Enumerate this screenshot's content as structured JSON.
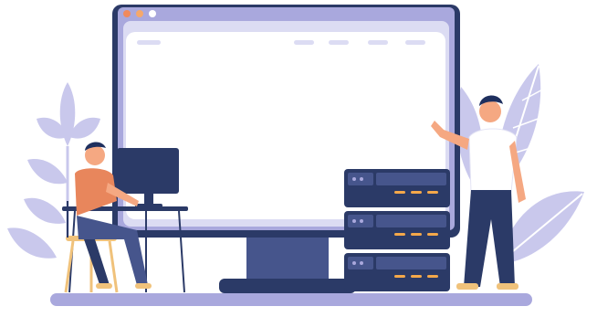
{
  "illustration": {
    "colors": {
      "monitor_bezel": "#2b3a67",
      "monitor_frame": "#a9a8dd",
      "screen": "#ffffff",
      "screen_bar": "#dcdcf3",
      "dot_red": "#f08a5d",
      "dot_orange": "#f5a86b",
      "dot_white": "#ffffff",
      "server_dark": "#2b3a67",
      "server_light": "#46558c",
      "server_led": "#f4a84a",
      "leaf": "#c9c8ec",
      "leaf_vein": "#ffffff",
      "ground": "#a9a8dd",
      "man_left_shirt": "#e8865c",
      "man_pants": "#2b3a67",
      "man_right_shirt": "#ffffff",
      "skin": "#f5a882",
      "hair": "#1e2f5e",
      "chair": "#f0c27b",
      "desk": "#2b3a67"
    },
    "icons": [
      "monitor-icon",
      "server-rack-icon",
      "computer-monitor-icon",
      "leaf-icon",
      "person-icon",
      "chair-icon",
      "desk-icon"
    ]
  }
}
